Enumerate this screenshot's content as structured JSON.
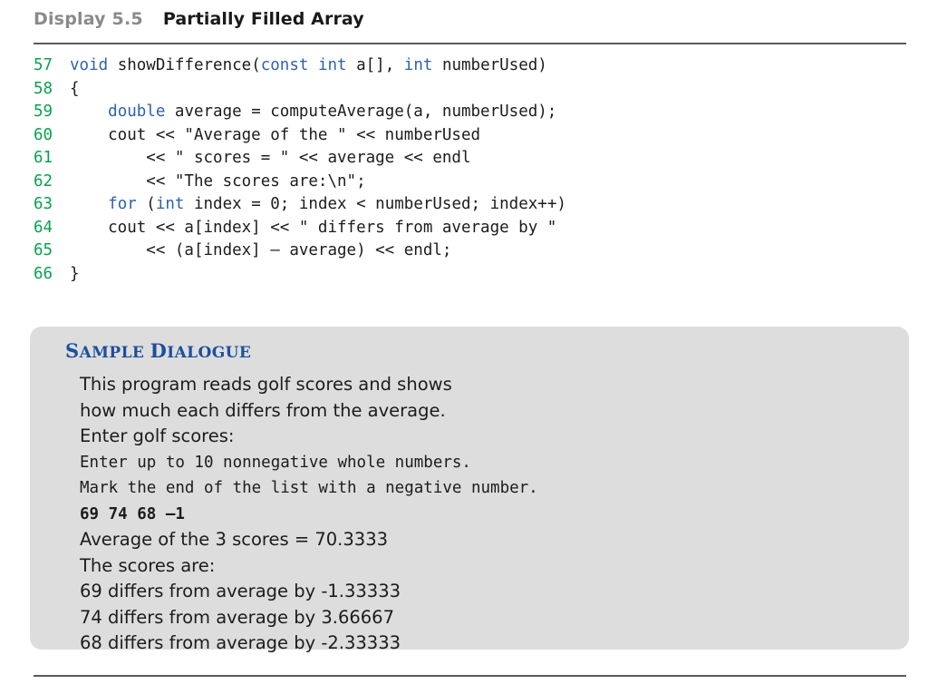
{
  "header": {
    "display_label": "Display 5.5",
    "title": "Partially Filled Array"
  },
  "colors": {
    "line_number_green": "#0aa14f",
    "keyword_blue": "#2f62aa",
    "heading_blue": "#1d4f9c",
    "label_gray": "#8a8a8a",
    "box_background": "#dddddd",
    "rule": "#5a5a5a"
  },
  "code": {
    "lines": [
      {
        "no": "57",
        "segments": [
          {
            "t": "",
            "kw": false
          },
          {
            "t": "void",
            "kw": true
          },
          {
            "t": " showDifference(",
            "kw": false
          },
          {
            "t": "const",
            "kw": true
          },
          {
            "t": " ",
            "kw": false
          },
          {
            "t": "int",
            "kw": true
          },
          {
            "t": " a[], ",
            "kw": false
          },
          {
            "t": "int",
            "kw": true
          },
          {
            "t": " numberUsed)",
            "kw": false
          }
        ]
      },
      {
        "no": "58",
        "segments": [
          {
            "t": "{",
            "kw": false
          }
        ]
      },
      {
        "no": "59",
        "segments": [
          {
            "t": "    ",
            "kw": false
          },
          {
            "t": "double",
            "kw": true
          },
          {
            "t": " average = computeAverage(a, numberUsed);",
            "kw": false
          }
        ]
      },
      {
        "no": "60",
        "segments": [
          {
            "t": "    cout << \"Average of the \" << numberUsed",
            "kw": false
          }
        ]
      },
      {
        "no": "61",
        "segments": [
          {
            "t": "        << \" scores = \" << average << endl",
            "kw": false
          }
        ]
      },
      {
        "no": "62",
        "segments": [
          {
            "t": "        << \"The scores are:\\n\";",
            "kw": false
          }
        ]
      },
      {
        "no": "63",
        "segments": [
          {
            "t": "    ",
            "kw": false
          },
          {
            "t": "for",
            "kw": true
          },
          {
            "t": " (",
            "kw": false
          },
          {
            "t": "int",
            "kw": true
          },
          {
            "t": " index = 0; index < numberUsed; index++)",
            "kw": false
          }
        ]
      },
      {
        "no": "64",
        "segments": [
          {
            "t": "    cout << a[index] << \" differs from average by \"",
            "kw": false
          }
        ]
      },
      {
        "no": "65",
        "segments": [
          {
            "t": "        << (a[index] – average) << endl;",
            "kw": false
          }
        ]
      },
      {
        "no": "66",
        "segments": [
          {
            "t": "}",
            "kw": false
          }
        ]
      }
    ]
  },
  "dialogue": {
    "heading_parts": [
      {
        "text": "S",
        "big": true
      },
      {
        "text": "AMPLE ",
        "big": false
      },
      {
        "text": "D",
        "big": true
      },
      {
        "text": "IALOGUE",
        "big": false
      }
    ],
    "heading_plain": "SAMPLE DIALOGUE",
    "lines": [
      {
        "text": "This program reads golf scores and shows",
        "style": "prop"
      },
      {
        "text": "how much each differs from the average.",
        "style": "prop"
      },
      {
        "text": "Enter golf scores:",
        "style": "prop"
      },
      {
        "text": "Enter up to 10 nonnegative whole numbers.",
        "style": "mono"
      },
      {
        "text": "Mark the end of the list with a negative number.",
        "style": "mono"
      },
      {
        "text": "69 74 68 –1",
        "style": "input"
      },
      {
        "text": "Average of the 3 scores = 70.3333",
        "style": "prop"
      },
      {
        "text": "The scores are:",
        "style": "prop"
      },
      {
        "text": "69 differs from average by -1.33333",
        "style": "prop"
      },
      {
        "text": "74 differs from average by 3.66667",
        "style": "prop"
      },
      {
        "text": "68 differs from average by -2.33333",
        "style": "prop"
      }
    ]
  }
}
